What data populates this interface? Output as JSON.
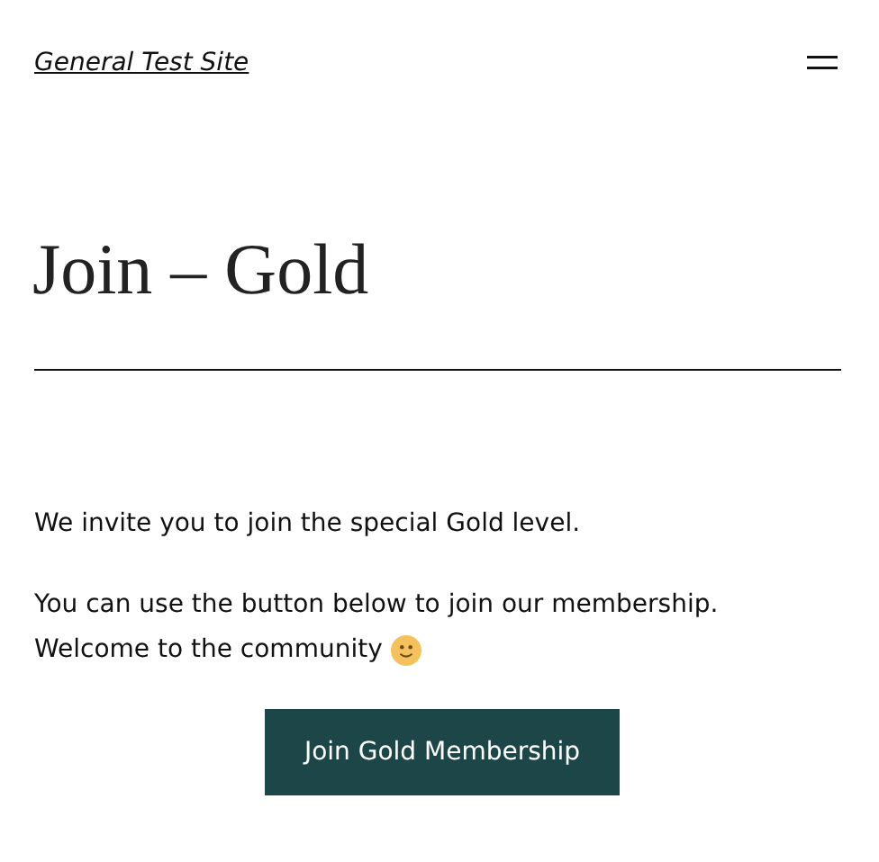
{
  "header": {
    "site_title": "General Test Site"
  },
  "page": {
    "title": "Join – Gold"
  },
  "content": {
    "paragraphs": [
      {
        "lines": [
          "We invite you to join the special Gold level."
        ]
      },
      {
        "lines": [
          "You can use the button below to join our membership.",
          "Welcome to the community"
        ]
      }
    ],
    "button": "Join Gold Membership"
  }
}
